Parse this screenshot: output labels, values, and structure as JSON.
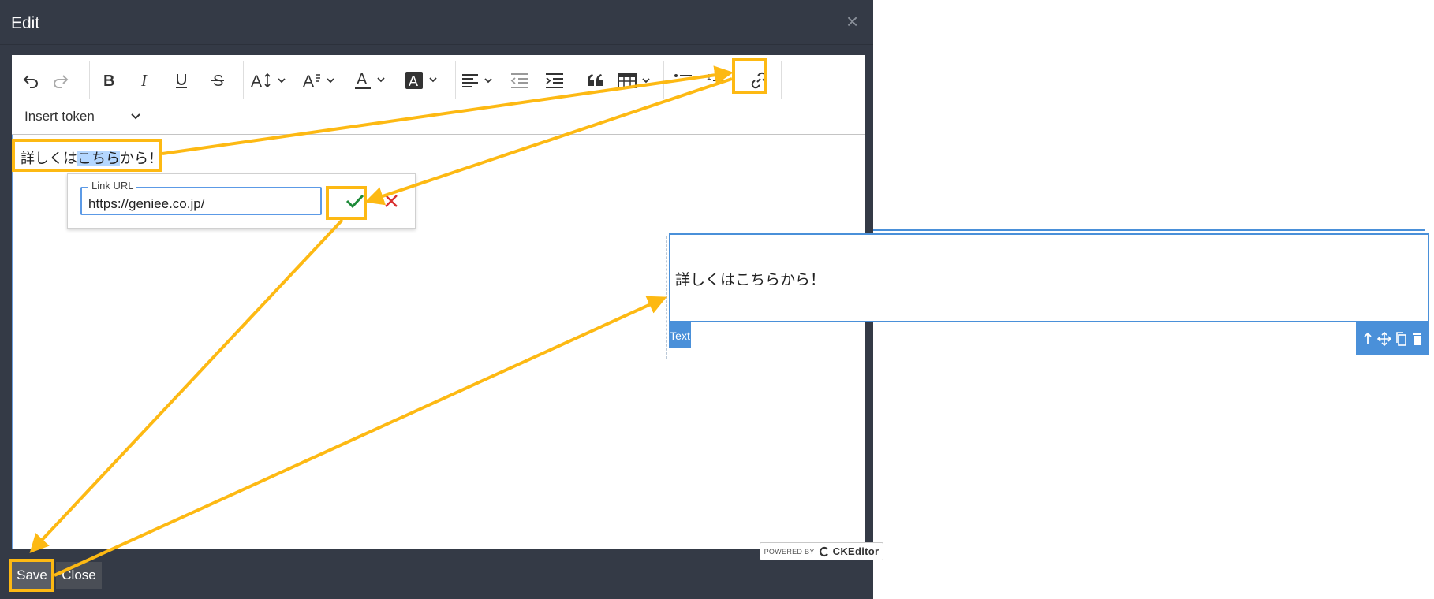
{
  "modal": {
    "title": "Edit",
    "close_glyph": "×",
    "buttons": {
      "save": "Save",
      "close": "Close"
    }
  },
  "toolbar": {
    "icons": [
      "undo-icon",
      "redo-icon",
      "bold-icon",
      "italic-icon",
      "underline-icon",
      "strikethrough-icon",
      "font-size-icon",
      "font-family-icon",
      "font-color-icon",
      "font-background-color-icon",
      "alignment-icon",
      "outdent-icon",
      "indent-icon",
      "blockquote-icon",
      "insert-table-icon",
      "bulleted-list-icon",
      "numbered-list-icon",
      "link-icon"
    ],
    "insert_token_label": "Insert token"
  },
  "editor": {
    "text_before": "詳しくは",
    "text_selected": "こちら",
    "text_after": "から！"
  },
  "link_balloon": {
    "label": "Link URL",
    "value": "https://geniee.co.jp/"
  },
  "powered_by": {
    "prefix": "POWERED BY",
    "brand": "CKEditor"
  },
  "preview": {
    "text": "詳しくはこちらから！",
    "tag": "Text"
  },
  "colors": {
    "highlight": "#fdb913",
    "modal_bg": "#343a46",
    "preview_accent": "#4a90d9",
    "selection": "#b4d7ff"
  }
}
